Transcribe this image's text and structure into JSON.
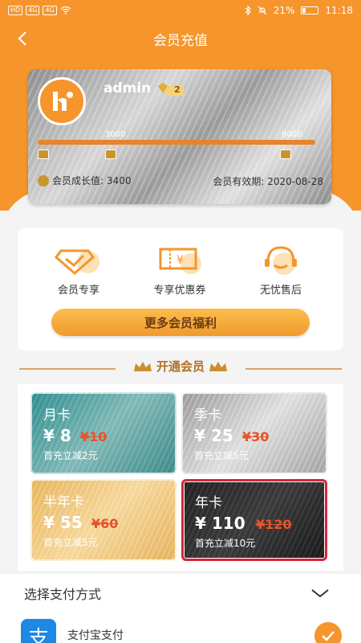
{
  "status_bar": {
    "left_icons": [
      "HD",
      "4G",
      "4G",
      "wifi"
    ],
    "battery": "21%",
    "time": "11:18"
  },
  "nav": {
    "title": "会员充值",
    "back_icon": "back-arrow-icon"
  },
  "card": {
    "username": "admin",
    "vip_level": "2",
    "level_marks": [
      "3000",
      "8000"
    ],
    "growth_label": "会员成长值:",
    "growth_value": "3400",
    "expiry_label": "会员有效期:",
    "expiry_value": "2020-08-28"
  },
  "benefits": {
    "items": [
      {
        "label": "会员专享",
        "icon": "member-diamond-icon"
      },
      {
        "label": "专享优惠券",
        "icon": "coupon-icon"
      },
      {
        "label": "无忧售后",
        "icon": "headset-icon"
      }
    ],
    "more_label": "更多会员福利"
  },
  "section_title": "开通会员",
  "plans": [
    {
      "name": "月卡",
      "price": "¥ 8",
      "old": "¥10",
      "note": "首充立减2元"
    },
    {
      "name": "季卡",
      "price": "¥ 25",
      "old": "¥30",
      "note": "首充立减5元"
    },
    {
      "name": "半年卡",
      "price": "¥ 55",
      "old": "¥60",
      "note": "首充立减5元"
    },
    {
      "name": "年卡",
      "price": "¥ 110",
      "old": "¥120",
      "note": "首充立减10元"
    }
  ],
  "payment": {
    "title": "选择支付方式",
    "method": "支付宝支付",
    "logo_text": "支"
  },
  "colors": {
    "brand": "#f5952b",
    "strike": "#e8532b",
    "selected_border": "#d7243a"
  }
}
